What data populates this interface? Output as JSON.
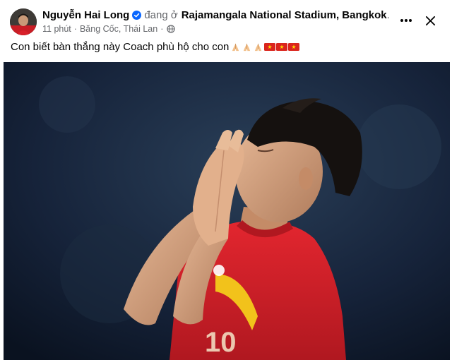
{
  "post": {
    "author_name": "Nguyễn Hai Long",
    "checkin_prefix": "đang ở",
    "checkin_place": "Rajamangala National Stadium, Bangkok",
    "checkin_suffix": ".",
    "time_ago": "11 phút",
    "separator": "·",
    "location": "Băng Cốc, Thái Lan",
    "caption": "Con biết bàn thắng này Coach phù hộ cho con",
    "caption_emojis": [
      "folded-hands-icon",
      "folded-hands-icon",
      "folded-hands-icon",
      "vietnam-flag-icon",
      "vietnam-flag-icon",
      "vietnam-flag-icon"
    ],
    "photo_subject": "player-praying"
  },
  "icons": {
    "verified": "verified-badge-icon",
    "audience": "globe-icon",
    "more": "more-options-icon",
    "close": "close-icon"
  },
  "colors": {
    "verified_blue": "#0866ff",
    "secondary_text": "#65676b",
    "jersey_red": "#d8202a",
    "jersey_trim": "#f2c21b"
  }
}
